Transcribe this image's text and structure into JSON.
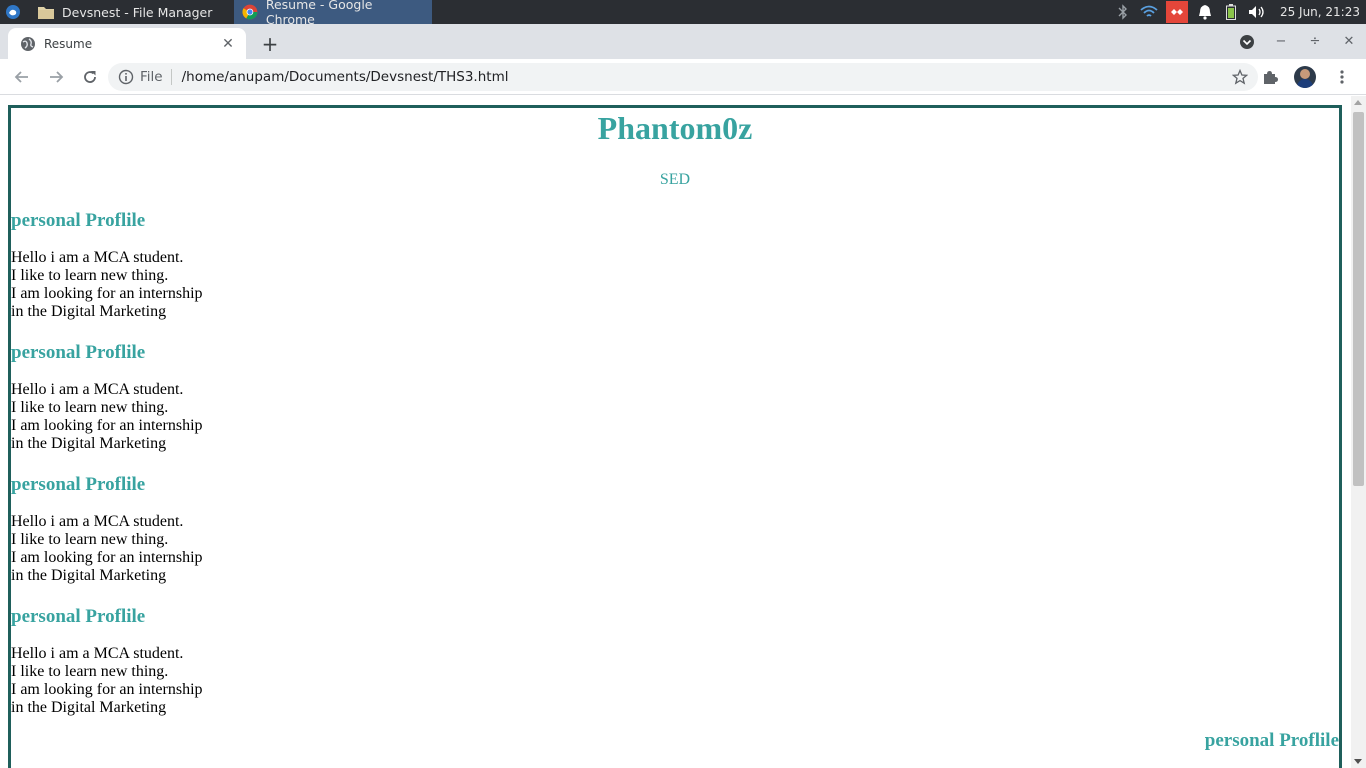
{
  "taskbar": {
    "tasks": [
      {
        "label": "Devsnest - File Manager",
        "icon": "folder-icon"
      },
      {
        "label": "Resume - Google Chrome",
        "icon": "chrome-icon"
      }
    ],
    "clock": "25 Jun, 21:23",
    "tray_icons": [
      "bluetooth-icon",
      "wifi-icon",
      "anydesk-icon",
      "bell-icon",
      "battery-icon",
      "volume-icon"
    ]
  },
  "browser": {
    "tab_title": "Resume",
    "url_scheme": "File",
    "url": "/home/anupam/Documents/Devsnest/THS3.html"
  },
  "page": {
    "name": "Phantom0z",
    "subtitle": "SED",
    "sections": [
      {
        "heading": "personal Proflile",
        "lines": [
          "Hello i am a MCA student.",
          "I like to learn new thing.",
          "I am looking for an internship",
          "in the Digital Marketing"
        ]
      },
      {
        "heading": "personal Proflile",
        "lines": [
          "Hello i am a MCA student.",
          "I like to learn new thing.",
          "I am looking for an internship",
          "in the Digital Marketing"
        ]
      },
      {
        "heading": "personal Proflile",
        "lines": [
          "Hello i am a MCA student.",
          "I like to learn new thing.",
          "I am looking for an internship",
          "in the Digital Marketing"
        ]
      },
      {
        "heading": "personal Proflile",
        "lines": [
          "Hello i am a MCA student.",
          "I like to learn new thing.",
          "I am looking for an internship",
          "in the Digital Marketing"
        ]
      }
    ],
    "right_heading": "personal Proflile"
  },
  "colors": {
    "accent": "#38a3a0",
    "border": "#1f5f5b",
    "taskbar": "#2b2e33",
    "active_task": "#3d5a80"
  }
}
